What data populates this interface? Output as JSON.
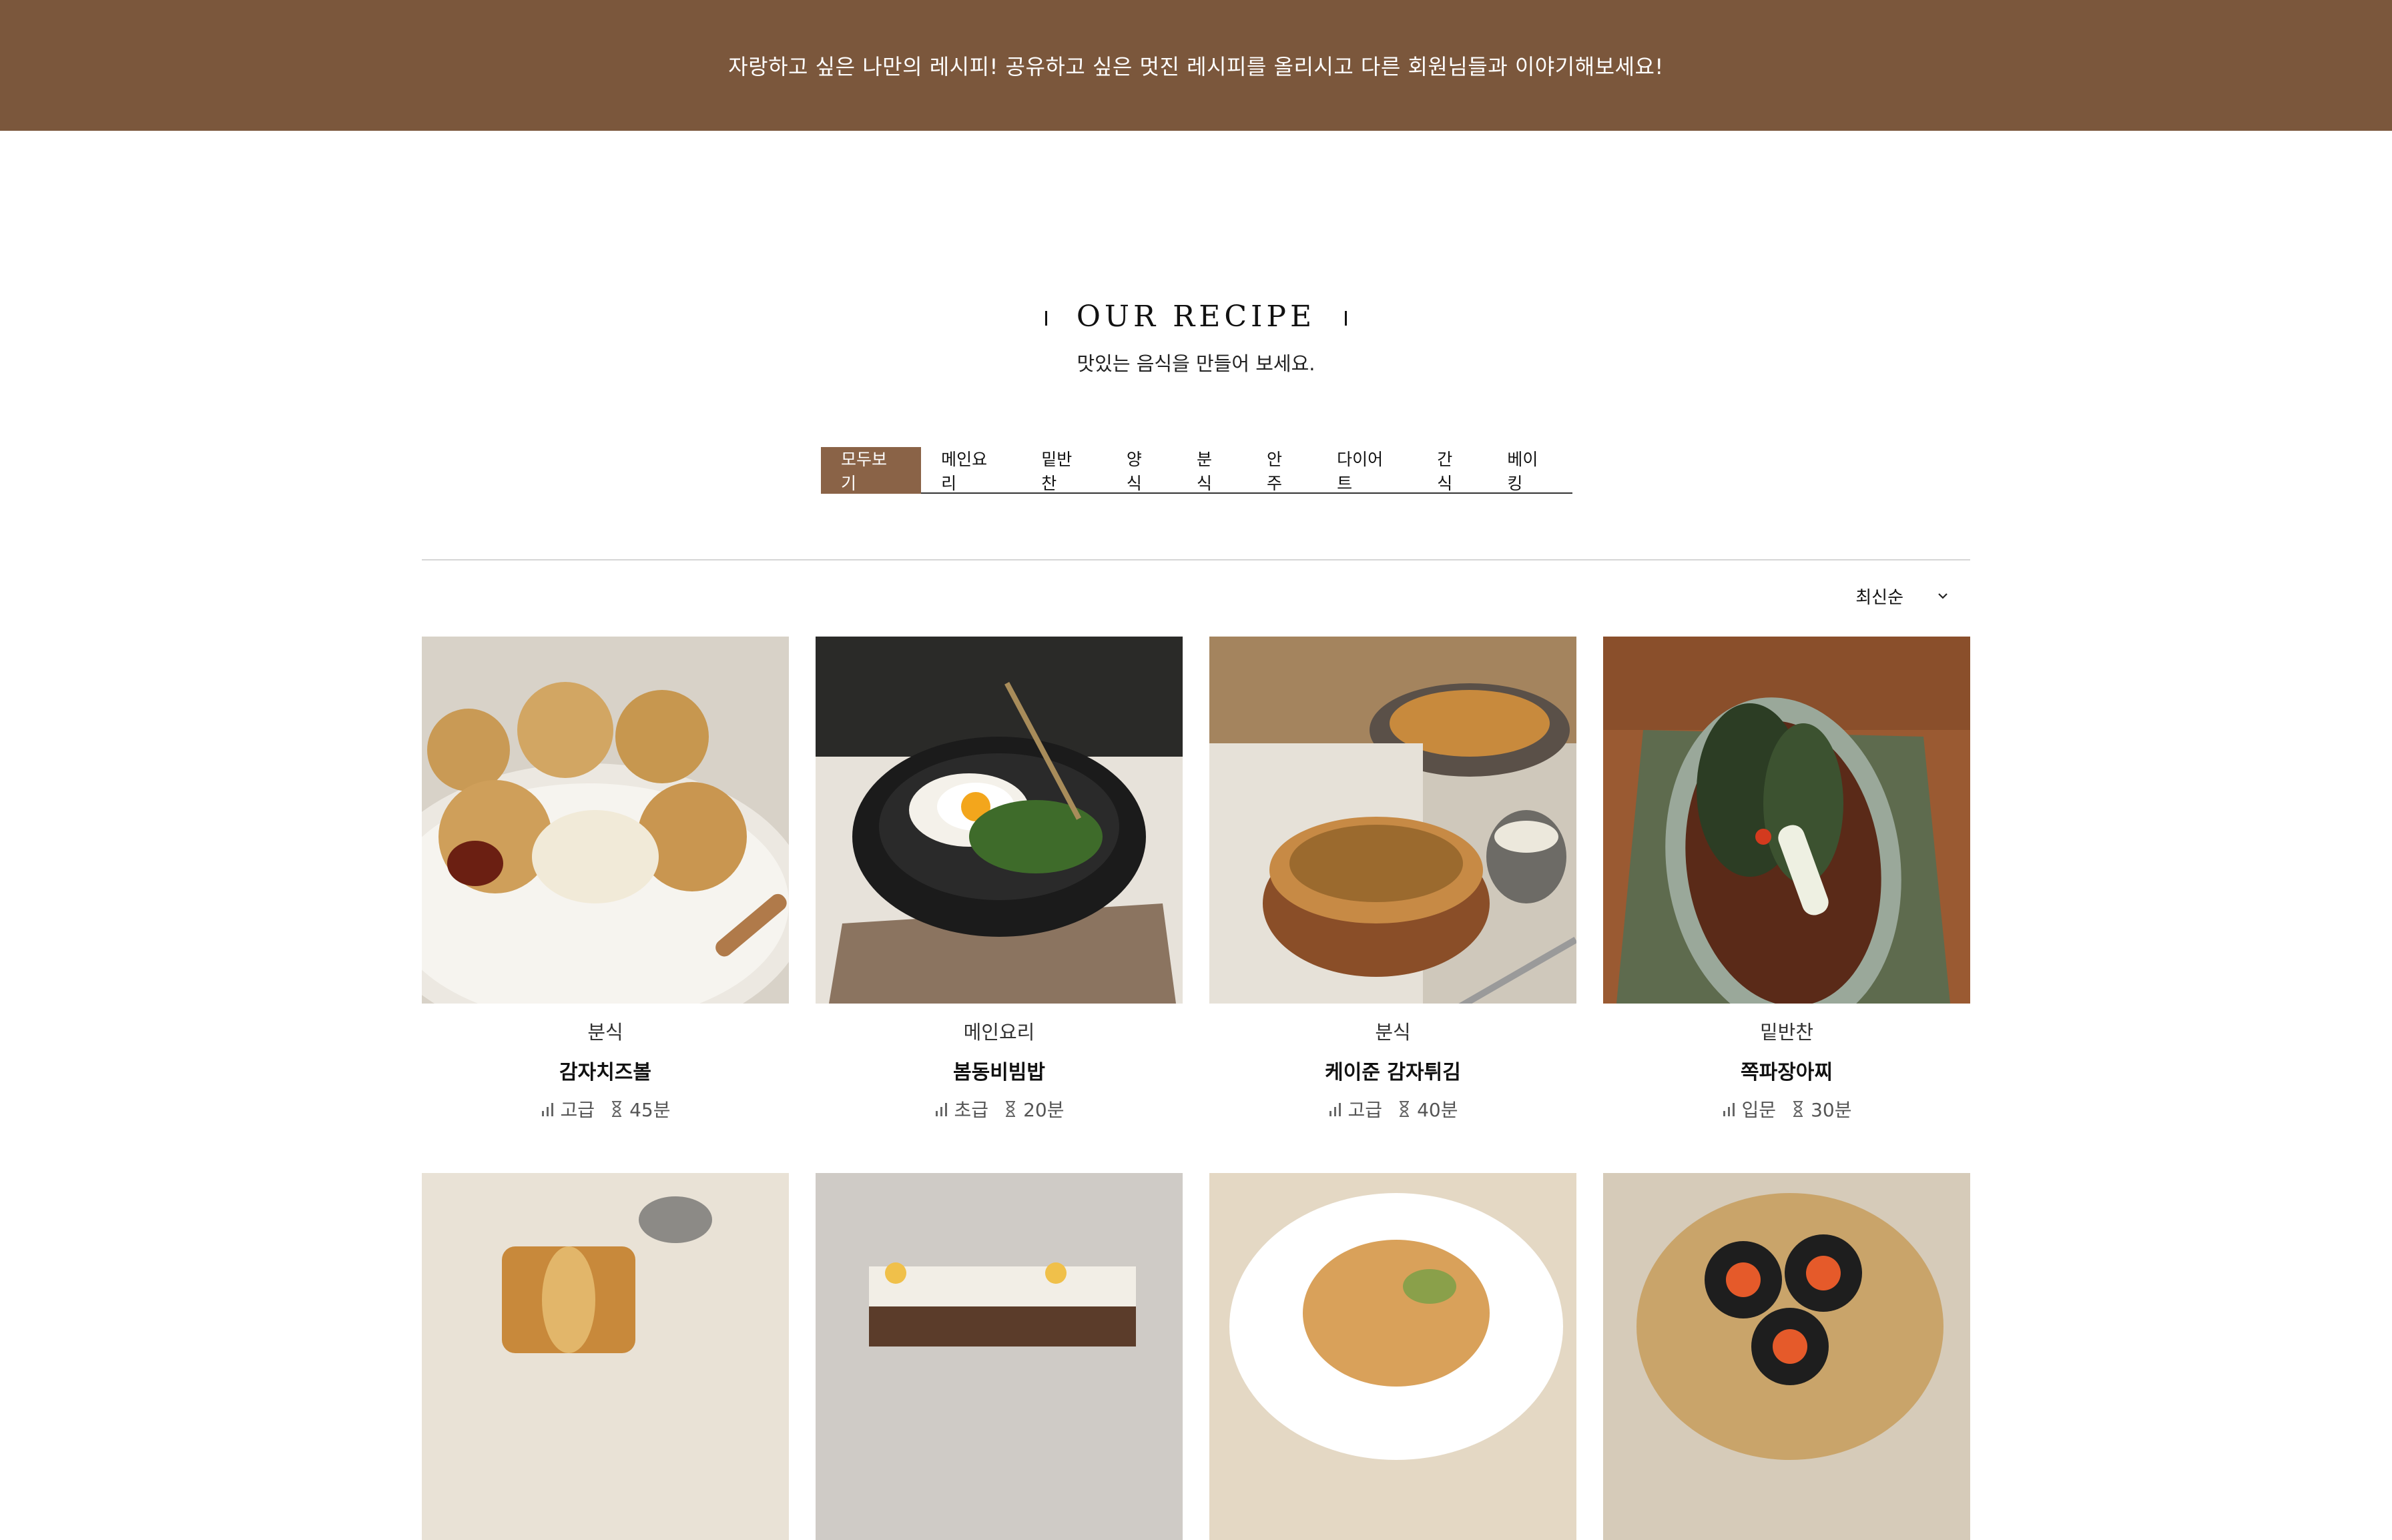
{
  "banner": {
    "text": "자랑하고 싶은 나만의 레시피! 공유하고 싶은 멋진 레시피를 올리시고 다른 회원님들과 이야기해보세요!"
  },
  "section": {
    "title": "OUR RECIPE",
    "subtitle": "맛있는 음식을 만들어 보세요."
  },
  "tabs": [
    {
      "label": "모두보기",
      "active": true
    },
    {
      "label": "메인요리"
    },
    {
      "label": "밑반찬"
    },
    {
      "label": "양식"
    },
    {
      "label": "분식"
    },
    {
      "label": "안주"
    },
    {
      "label": "다이어트"
    },
    {
      "label": "간식"
    },
    {
      "label": "베이킹"
    }
  ],
  "sort": {
    "selected": "최신순",
    "icon": "chevron-down-icon"
  },
  "recipes": [
    {
      "category": "분식",
      "name": "감자치즈볼",
      "level": "고급",
      "time": "45분",
      "image": "cheese-balls"
    },
    {
      "category": "메인요리",
      "name": "봄동비빔밥",
      "level": "초급",
      "time": "20분",
      "image": "bibimbap"
    },
    {
      "category": "분식",
      "name": "케이준 감자튀김",
      "level": "고급",
      "time": "40분",
      "image": "cajun-fries"
    },
    {
      "category": "밑반찬",
      "name": "쪽파장아찌",
      "level": "입문",
      "time": "30분",
      "image": "scallion-pickle"
    },
    {
      "category": "",
      "name": "",
      "level": "",
      "time": "",
      "image": "roll-cake"
    },
    {
      "category": "",
      "name": "",
      "level": "",
      "time": "",
      "image": "layer-cake"
    },
    {
      "category": "",
      "name": "",
      "level": "",
      "time": "",
      "image": "pasta"
    },
    {
      "category": "",
      "name": "",
      "level": "",
      "time": "",
      "image": "kimbap"
    }
  ],
  "colors": {
    "banner": "#7b573c",
    "tab_active": "#8a6347"
  }
}
